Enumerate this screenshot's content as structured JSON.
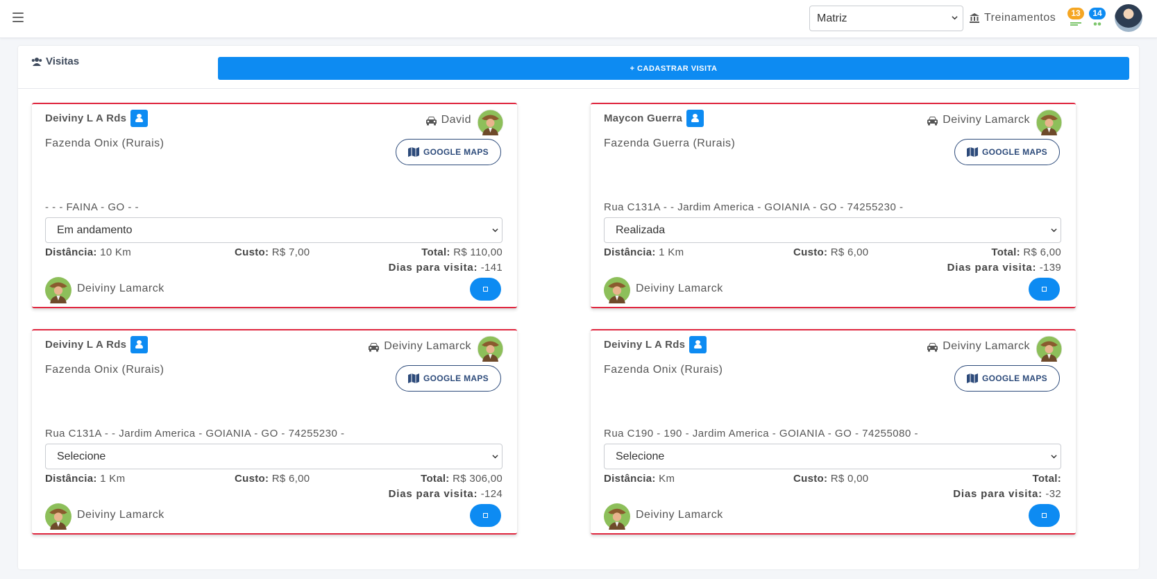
{
  "topbar": {
    "branch": {
      "selected": "Matriz",
      "options": [
        "Matriz"
      ]
    },
    "trainings_label": "Treinamentos",
    "notifications": [
      {
        "count": "13",
        "color": "#f5a623"
      },
      {
        "count": "14",
        "color": "#0d8bf2"
      }
    ]
  },
  "panel": {
    "title": "Visitas",
    "add_button": "+ CADASTRAR VISITA"
  },
  "labels": {
    "maps": "GOOGLE MAPS",
    "distance": "Distância:",
    "cost": "Custo:",
    "total": "Total:",
    "days": "Dias para visita:"
  },
  "visits": [
    {
      "client": "Deiviny L A Rds",
      "driver": "David",
      "farm": "Fazenda Onix (Rurais)",
      "address": "- - - FAINA - GO - -",
      "status": "Em andamento",
      "distance": "10 Km",
      "cost": "R$ 7,00",
      "total": "R$ 110,00",
      "days": "-141",
      "owner": "Deiviny Lamarck"
    },
    {
      "client": "Maycon Guerra",
      "driver": "Deiviny Lamarck",
      "farm": "Fazenda Guerra (Rurais)",
      "address": "Rua C131A - - Jardim America - GOIANIA - GO - 74255230 -",
      "status": "Realizada",
      "distance": "1 Km",
      "cost": "R$ 6,00",
      "total": "R$ 6,00",
      "days": "-139",
      "owner": "Deiviny Lamarck"
    },
    {
      "client": "Deiviny L A Rds",
      "driver": "Deiviny Lamarck",
      "farm": "Fazenda Onix (Rurais)",
      "address": "Rua C131A - - Jardim America - GOIANIA - GO - 74255230 -",
      "status": "Selecione",
      "distance": "1 Km",
      "cost": "R$ 6,00",
      "total": "R$ 306,00",
      "days": "-124",
      "owner": "Deiviny Lamarck"
    },
    {
      "client": "Deiviny L A Rds",
      "driver": "Deiviny Lamarck",
      "farm": "Fazenda Onix (Rurais)",
      "address": "Rua C190 - 190 - Jardim America - GOIANIA - GO - 74255080 -",
      "status": "Selecione",
      "distance": "Km",
      "cost": "R$ 0,00",
      "total": "",
      "days": "-32",
      "owner": "Deiviny Lamarck"
    }
  ],
  "colors": {
    "accent": "#0d8bf2",
    "card_border": "#e0263f",
    "maps_outline": "#2c4a7a"
  }
}
